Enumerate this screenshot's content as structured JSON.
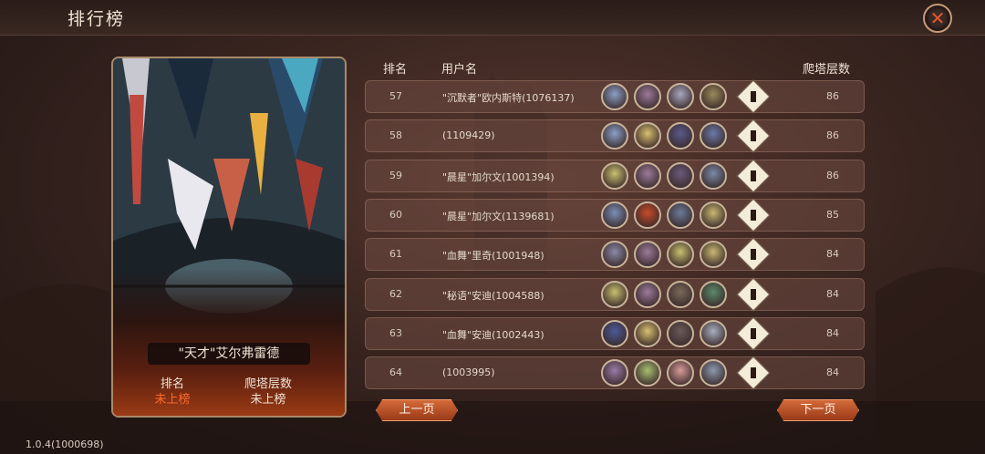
{
  "header": {
    "title": "排行榜"
  },
  "colors": {
    "accent": "#e8572e",
    "rank_value": "#ff6a2a",
    "row_bg": "#6e4b41",
    "button": "#c25a2e"
  },
  "hero_card": {
    "name": "\"天才\"艾尔弗雷德",
    "rank_label": "排名",
    "rank_value": "未上榜",
    "floors_label": "爬塔层数",
    "floors_value": "未上榜"
  },
  "table": {
    "columns": {
      "rank": "排名",
      "username": "用户名",
      "floors": "爬塔层数"
    },
    "rows": [
      {
        "rank": "57",
        "username": "\"沉默者\"欧内斯特(1076137)",
        "floors": "86",
        "avatars": [
          "#8aa0c8",
          "#9a7a9a",
          "#a8a8c0",
          "#9a8a5a"
        ]
      },
      {
        "rank": "58",
        "username": "(1109429)",
        "floors": "86",
        "avatars": [
          "#8aa0c8",
          "#d8c070",
          "#5a5a8a",
          "#6a7aa8"
        ]
      },
      {
        "rank": "59",
        "username": "\"晨星\"加尔文(1001394)",
        "floors": "86",
        "avatars": [
          "#c8c070",
          "#9a7a9a",
          "#6a5a7a",
          "#7a8aa8"
        ]
      },
      {
        "rank": "60",
        "username": "\"晨星\"加尔文(1139681)",
        "floors": "85",
        "avatars": [
          "#7a90b8",
          "#c84a2a",
          "#6a7a9a",
          "#c8b870"
        ]
      },
      {
        "rank": "61",
        "username": "\"血舞\"里奇(1001948)",
        "floors": "84",
        "avatars": [
          "#8a8aa8",
          "#9a7a9a",
          "#c8c070",
          "#c8b870"
        ]
      },
      {
        "rank": "62",
        "username": "\"秘语\"安迪(1004588)",
        "floors": "84",
        "avatars": [
          "#c8c070",
          "#9a7a9a",
          "#7a6a5a",
          "#5a8a6a"
        ]
      },
      {
        "rank": "63",
        "username": "\"血舞\"安迪(1002443)",
        "floors": "84",
        "avatars": [
          "#4a5a9a",
          "#d8c070",
          "#6a5a5a",
          "#a8b0c0"
        ]
      },
      {
        "rank": "64",
        "username": "(1003995)",
        "floors": "84",
        "avatars": [
          "#9a7aa8",
          "#a8c070",
          "#d89a9a",
          "#8a9ab0"
        ]
      }
    ]
  },
  "pagination": {
    "prev_label": "上一页",
    "next_label": "下一页"
  },
  "footer": {
    "version": "1.0.4(1000698)"
  }
}
